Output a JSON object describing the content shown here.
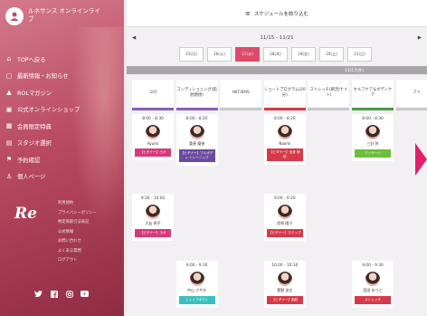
{
  "sidebar": {
    "title": "ルネサンス オンラインライブ",
    "brand": "Re",
    "nav": [
      {
        "icon": "home-icon",
        "glyph": "⌂",
        "label": "TOPへ戻る"
      },
      {
        "icon": "speech-icon",
        "glyph": "▢",
        "label": "最新情報・お知らせ"
      },
      {
        "icon": "user-icon",
        "glyph": "▲",
        "label": "ROLマガジン"
      },
      {
        "icon": "cart-icon",
        "glyph": "▣",
        "label": "公式オンラインショップ"
      },
      {
        "icon": "gift-icon",
        "glyph": "▩",
        "label": "会員限定特典"
      },
      {
        "icon": "calendar-icon",
        "glyph": "▤",
        "label": "スタジオ選択"
      },
      {
        "icon": "flag-icon",
        "glyph": "⚑",
        "label": "予約確認"
      },
      {
        "icon": "person-icon",
        "glyph": "♙",
        "label": "個人ページ"
      }
    ],
    "links": [
      "利用規約",
      "プライバシーポリシー",
      "特定商取引法表記",
      "公式情報",
      "お問い合わせ",
      "よくある質問",
      "ログアウト"
    ]
  },
  "main": {
    "header_title": "スケジュールを絞り込む",
    "week_label": "11/15 - 11/21",
    "prev_label": "◀",
    "next_label": "▶",
    "days": [
      "15(月)",
      "16(火)",
      "17(水)",
      "18(木)",
      "19(金)",
      "20(土)",
      "21(日)"
    ],
    "selected_day_index": 2,
    "date_band": "11/17(水)",
    "columns": [
      {
        "header": "ヨガ",
        "color": "#8a5fb5"
      },
      {
        "header": "コンディショニング(脂肪燃焼)",
        "color": "#8a5fb5"
      },
      {
        "header": "HIIT/EMS",
        "color": "#c9c6cc"
      },
      {
        "header": "ショートプログラム(20分)",
        "color": "#d63a4a"
      },
      {
        "header": "ストレッチ(朝活/ナイト)",
        "color": "#c9c6cc"
      },
      {
        "header": "セルフケア＆ボディケア",
        "color": "#4a9a4a"
      },
      {
        "header": "ファ",
        "color": "#c9c6cc"
      }
    ],
    "cards": [
      {
        "col": 0,
        "row": 0,
        "time": "8:00 - 8:30",
        "name": "Ayumi",
        "tag": "【ビギナー】ヨガ",
        "tag_color": "#d63a7a"
      },
      {
        "col": 1,
        "row": 0,
        "time": "8:00 - 8:20",
        "name": "桑原 優香",
        "tag": "【ビギナー】フルボディ トレーニング",
        "tag_color": "#6b4aa0"
      },
      {
        "col": 3,
        "row": 0,
        "time": "8:00 - 8:20",
        "name": "Naomi",
        "tag": "【ビギナー】全身 燃焼",
        "tag_color": "#d63a4a"
      },
      {
        "col": 5,
        "row": 0,
        "time": "8:00 - 8:30",
        "name": "三好 怜",
        "tag": "マッサージ",
        "tag_color": "#6bbf3a"
      },
      {
        "col": 0,
        "row": 1,
        "time": "9:30 - 10:00",
        "name": "大友 明子",
        "tag": "【ビギナー】ヨガ",
        "tag_color": "#d63a7a"
      },
      {
        "col": 3,
        "row": 1,
        "time": "9:00 - 9:20",
        "name": "岸原 陽子",
        "tag": "【ビギナー】ステップ",
        "tag_color": "#d63a4a"
      },
      {
        "col": 1,
        "row": 2,
        "time": "9:00 - 9:30",
        "name": "中山 さやか",
        "tag": "シェイプボディ",
        "tag_color": "#3ac0c0"
      },
      {
        "col": 3,
        "row": 2,
        "time": "10:00 - 10:30",
        "name": "菅野 涼太",
        "tag": "【ビギナー】脂肪",
        "tag_color": "#d63a4a"
      },
      {
        "col": 5,
        "row": 2,
        "time": "9:00 - 9:30",
        "name": "西田 ゆうと",
        "tag": "ストレッチ",
        "tag_color": "#d63a4a"
      }
    ]
  }
}
